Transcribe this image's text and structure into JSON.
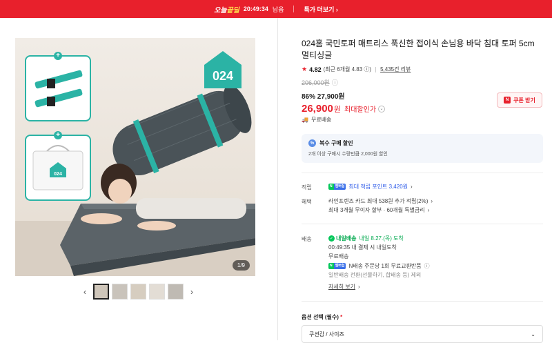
{
  "topbar": {
    "brand_prefix": "오늘",
    "brand_suffix": "끝딜",
    "timer": "20:49:34",
    "timer_suffix": "남음",
    "more_label": "특가 더보기"
  },
  "gallery": {
    "logo_text": "024",
    "inset_logo_text": "024",
    "counter": "1/9",
    "thumb_count": 5,
    "prev_icon": "chevron-left-icon",
    "next_icon": "chevron-right-icon"
  },
  "product": {
    "title": "024홈 국민토퍼 매트리스 푹신한 접이식 손님용 바닥 침대 토퍼 5cm 멀티싱글",
    "rating": "4.82",
    "recent_rating": "(최근 6개월 4.83",
    "reviews": "5,435건 리뷰",
    "original_price": "206,000원",
    "discount_line": "86% 27,900원",
    "price": "26,900",
    "price_unit": "원",
    "max_discount": "최대할인가",
    "coupon_label": "쿠폰 받기",
    "shipping": "무료배송"
  },
  "multi_buy": {
    "title": "복수 구매 할인",
    "desc": "2개 이상 구매시 수량만큼 2,000원 할인"
  },
  "benefits": {
    "points_label": "적립",
    "points_text": "최대 적립 포인트 3,420원",
    "benefit_label": "혜택",
    "card_text": "라인프렌즈 카드 최대 538원 추가 적립(2%)",
    "install_text": "최대 3개월 무이자 할부 · 60개월 특별금리"
  },
  "delivery": {
    "label": "배송",
    "today_badge": "내일배송",
    "arrival": "내일 8.27.(목) 도착",
    "cutoff": "00:49:35  내 결제 시 내일도착",
    "free": "무료배송",
    "npay_text": "N배송 주문당 1회 무료교환반품",
    "exclude": "일반배송 전환(선물하기, 합배송 등) 제외",
    "detail_link": "자세히 보기"
  },
  "option": {
    "label": "옵션 선택 (필수)",
    "required_mark": "*",
    "selected": "쿠션감 / 사이즈"
  }
}
